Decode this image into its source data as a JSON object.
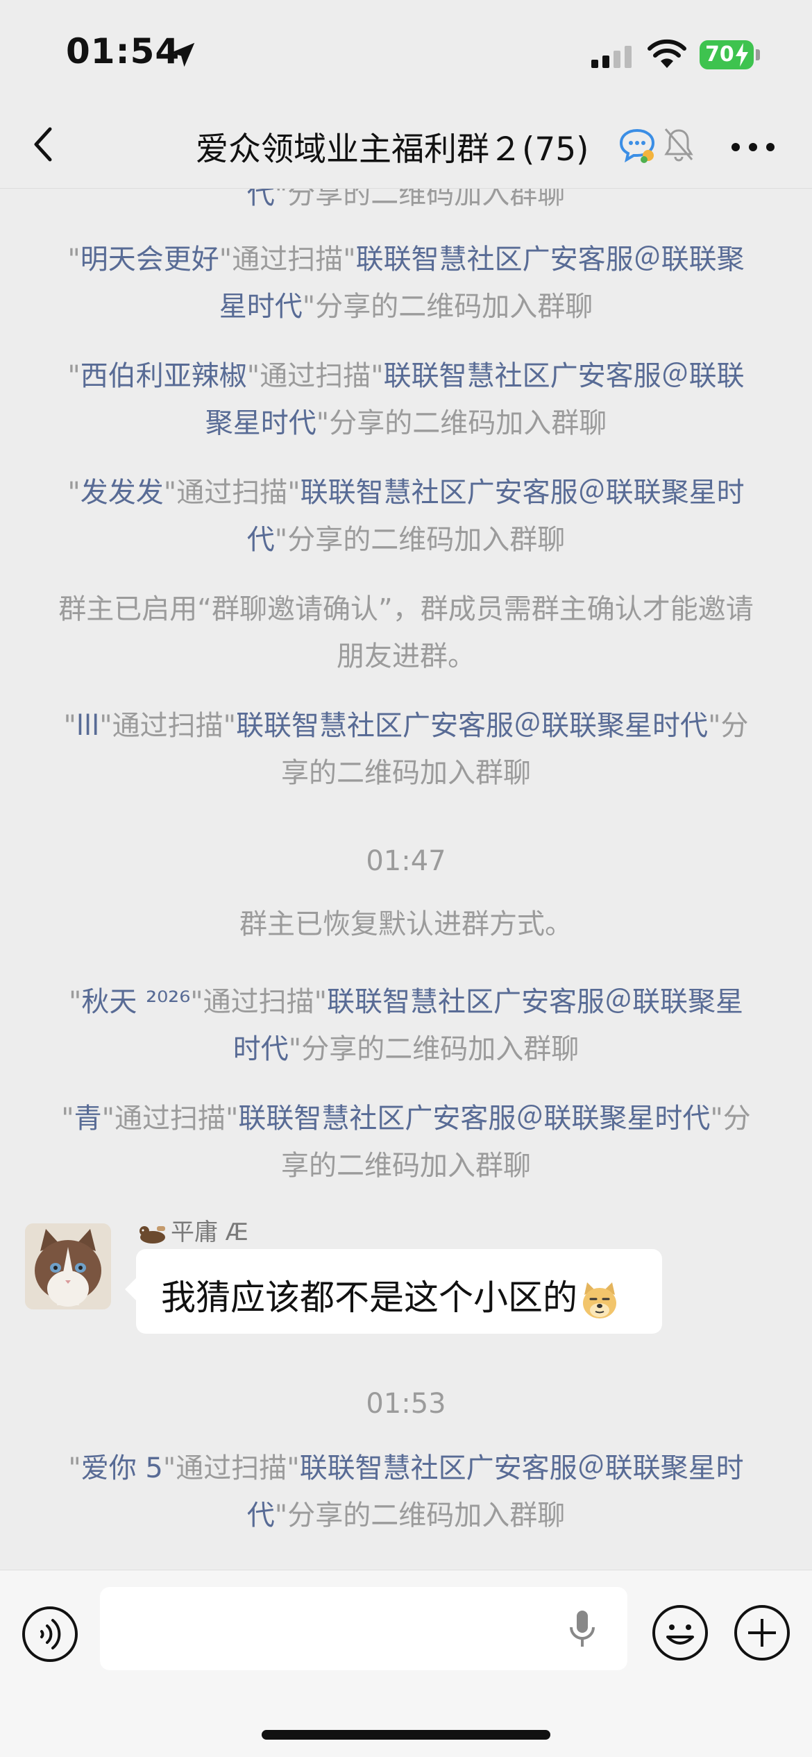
{
  "status": {
    "time": "01:54",
    "battery": "70"
  },
  "nav": {
    "title": "爱众领域业主福利群２",
    "count": "(75)"
  },
  "messages": [
    {
      "pre": "代",
      "post": "\"分享的二维码加入群聊"
    },
    {
      "q1": "\"",
      "name": "明天会更好",
      "q2": "\"通过扫描\"",
      "source": "联联智慧社区广安客服＠联联聚星时代",
      "post": "\"分享的二维码加入群聊"
    },
    {
      "q1": "\"",
      "name": "西伯利亚辣椒",
      "q2": "\"通过扫描\"",
      "source": "联联智慧社区广安客服＠联联聚星时代",
      "post": "\"分享的二维码加入群聊"
    },
    {
      "q1": "\"",
      "name": "发发发",
      "q2": "\"通过扫描\"",
      "source": "联联智慧社区广安客服＠联联聚星时代",
      "post": "\"分享的二维码加入群聊"
    },
    {
      "text": "群主已启用“群聊邀请确认”，群成员需群主确认才能邀请朋友进群。"
    },
    {
      "q1": "\"",
      "name": "lll",
      "q2": "\"通过扫描\"",
      "source": "联联智慧社区广安客服＠联联聚星时代",
      "post": "\"分享的二维码加入群聊"
    },
    {
      "time": "01:47"
    },
    {
      "text": "群主已恢复默认进群方式。"
    },
    {
      "q1": "\"",
      "name": "秋天 ²⁰²⁶",
      "q2": "\"通过扫描\"",
      "source": "联联智慧社区广安客服＠联联聚星时代",
      "post": "\"分享的二维码加入群聊"
    },
    {
      "q1": "\"",
      "name": "青",
      "q2": "\"通过扫描\"",
      "source": "联联智慧社区广安客服＠联联聚星时代",
      "post": "\"分享的二维码加入群聊"
    },
    {
      "time": "01:53"
    },
    {
      "q1": "\"",
      "name": "爱你 5",
      "q2": "\"通过扫描\"",
      "source": "联联智慧社区广安客服＠联联聚星时代",
      "post": "\"分享的二维码加入群聊"
    }
  ],
  "chat_message": {
    "sender": "平庸 Æ",
    "text": "我猜应该都不是这个小区的"
  },
  "colors": {
    "background": "#ededed",
    "system_text": "#9b9b9b",
    "name_link": "#586b95",
    "battery": "#3ec34f"
  },
  "icons": [
    "location-arrow-icon",
    "signal-icon",
    "wifi-icon",
    "back-icon",
    "chat-bubble-icon",
    "bell-muted-icon",
    "more-icon",
    "voice-icon",
    "mic-icon",
    "emoji-icon",
    "plus-icon"
  ]
}
